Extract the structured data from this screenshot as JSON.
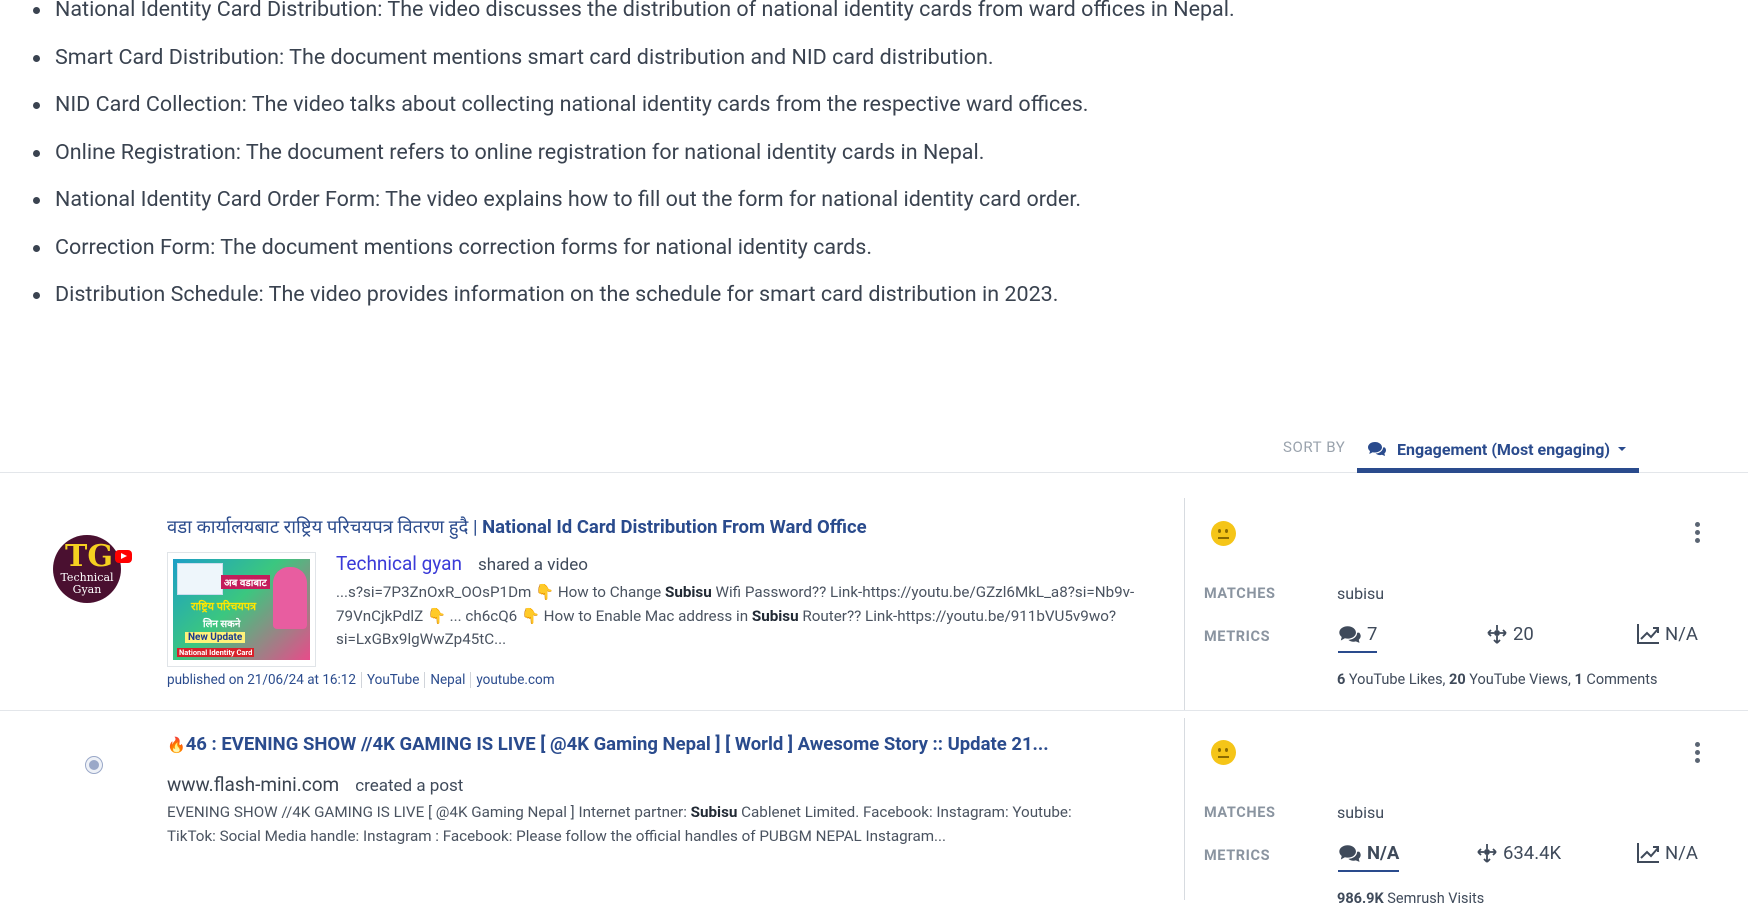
{
  "summary_bullets": [
    "National Identity Card Distribution: The video discusses the distribution of national identity cards from ward offices in Nepal.",
    "Smart Card Distribution: The document mentions smart card distribution and NID card distribution.",
    "NID Card Collection: The video talks about collecting national identity cards from the respective ward offices.",
    "Online Registration: The document refers to online registration for national identity cards in Nepal.",
    "National Identity Card Order Form: The video explains how to fill out the form for national identity card order.",
    "Correction Form: The document mentions correction forms for national identity cards.",
    "Distribution Schedule: The video provides information on the schedule for smart card distribution in 2023."
  ],
  "sort": {
    "label": "SORT BY",
    "value": "Engagement (Most engaging)"
  },
  "mentions": [
    {
      "title_native": "वडा कार्यालयबाट राष्ट्रिय परिचयपत्र वितरण हुदै |",
      "title": "National Id Card Distribution From Ward Office",
      "avatar_text": "TG",
      "avatar_subtext": "Technical Gyan",
      "thumb_text_1": "अब वडाबाट",
      "thumb_text_2": "राष्ट्रिय परिचयपत्र",
      "thumb_text_3": "लिन सकने",
      "thumb_text_4": "New Update",
      "thumb_text_5": "National Identity Card",
      "author": "Technical gyan",
      "action": "shared a video",
      "snippet_1": "...s?si=7P3ZnOxR_OOsP1Dm 👇 How to Change ",
      "snippet_kw_1": "Subisu",
      "snippet_2": " Wifi Password?? Link-https://youtu.be/GZzl6MkL_a8?si=Nb9v-79VnCjkPdlZ 👇 ... ch6cQ6 👇 How to Enable Mac address in ",
      "snippet_kw_2": "Subisu",
      "snippet_3": " Router?? Link-https://youtu.be/911bVU5v9wo?si=LxGBx9lgWwZp45tC...",
      "published": "published on 21/06/24 at 16:12",
      "platform": "YouTube",
      "country": "Nepal",
      "domain": "youtube.com",
      "matches_label": "MATCHES",
      "matches": "subisu",
      "metrics_label": "METRICS",
      "comments": "7",
      "reach": "20",
      "trend": "N/A",
      "stat_1_num": "6",
      "stat_1_lbl": " YouTube Likes, ",
      "stat_2_num": "20",
      "stat_2_lbl": " YouTube Views, ",
      "stat_3_num": "1",
      "stat_3_lbl": " Comments"
    },
    {
      "emoji": "🔥",
      "title": "46 : EVENING SHOW //4K GAMING IS LIVE [ @4K Gaming Nepal ] [ World ] Awesome Story :: Update 21...",
      "author": "www.flash-mini.com",
      "action": "created a post",
      "snippet_1": "EVENING SHOW //4K GAMING IS LIVE [ @4K Gaming Nepal ] Internet partner: ",
      "snippet_kw_1": "Subisu",
      "snippet_2": " Cablenet Limited. Facebook: Instagram: Youtube: TikTok: Social Media handle: Instagram : Facebook: Please follow the official handles of PUBGM NEPAL Instagram...",
      "matches_label": "MATCHES",
      "matches": "subisu",
      "metrics_label": "METRICS",
      "comments": "N/A",
      "reach": "634.4K",
      "trend": "N/A",
      "stat_1_num": "986.9K",
      "stat_1_lbl": " Semrush Visits"
    }
  ],
  "colors": {
    "accent": "#2a4b8d",
    "link_author": "#3b3bd8",
    "sentiment_neutral": "#f5c518"
  }
}
